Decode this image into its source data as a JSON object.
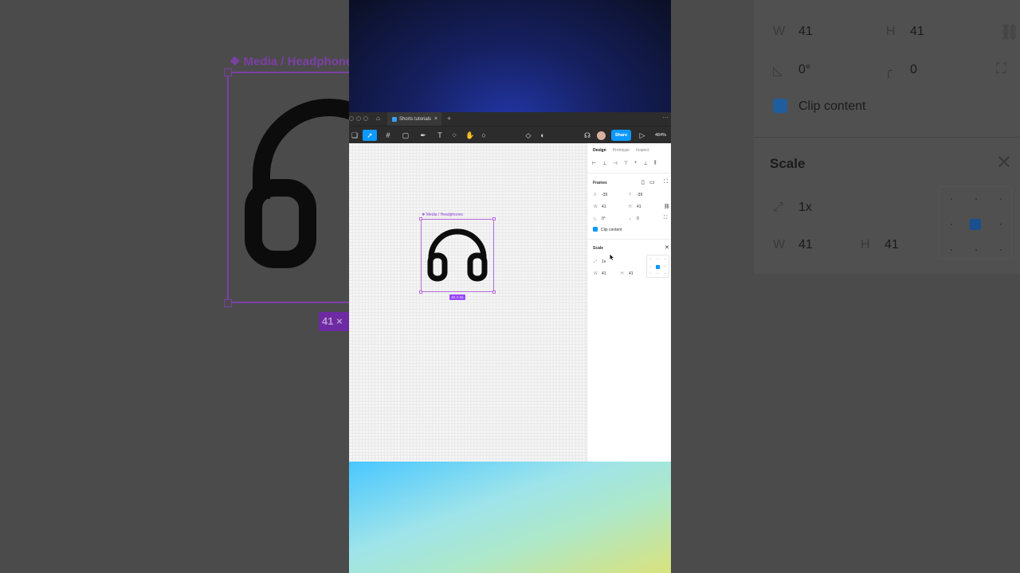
{
  "background_left": {
    "frame_label": "Media / Headphones",
    "size_tag": "41 ×"
  },
  "background_right": {
    "w_label": "W",
    "w_value": "41",
    "h_label": "H",
    "h_value": "41",
    "rotation": "0°",
    "radius": "0",
    "clip_content": "Clip content",
    "scale_title": "Scale",
    "scale_value": "1x",
    "scale_w_label": "W",
    "scale_w_value": "41",
    "scale_h_label": "H",
    "scale_h_value": "41"
  },
  "app": {
    "tab_title": "Shorts tutorials",
    "tab_close": "×",
    "new_tab": "+",
    "more_menu": "···",
    "share_label": "Share",
    "zoom": "484%",
    "accent_color": "#0d99ff",
    "selection_color": "#9747ff"
  },
  "canvas": {
    "frame_label": "Media / Headphones",
    "size_tag": "41 × 41"
  },
  "properties": {
    "tabs": [
      "Design",
      "Prototype",
      "Inspect"
    ],
    "frames_label": "Frames",
    "x_label": "X",
    "x_value": "-39",
    "y_label": "Y",
    "y_value": "-39",
    "w_label": "W",
    "w_value": "41",
    "h_label": "H",
    "h_value": "41",
    "rotation_value": "0°",
    "radius_value": "0",
    "clip_content": "Clip content",
    "scale_title": "Scale",
    "scale_value": "1x",
    "scale_w_label": "W",
    "scale_w_value": "41",
    "scale_h_label": "H",
    "scale_h_value": "41"
  },
  "help_label": "?"
}
